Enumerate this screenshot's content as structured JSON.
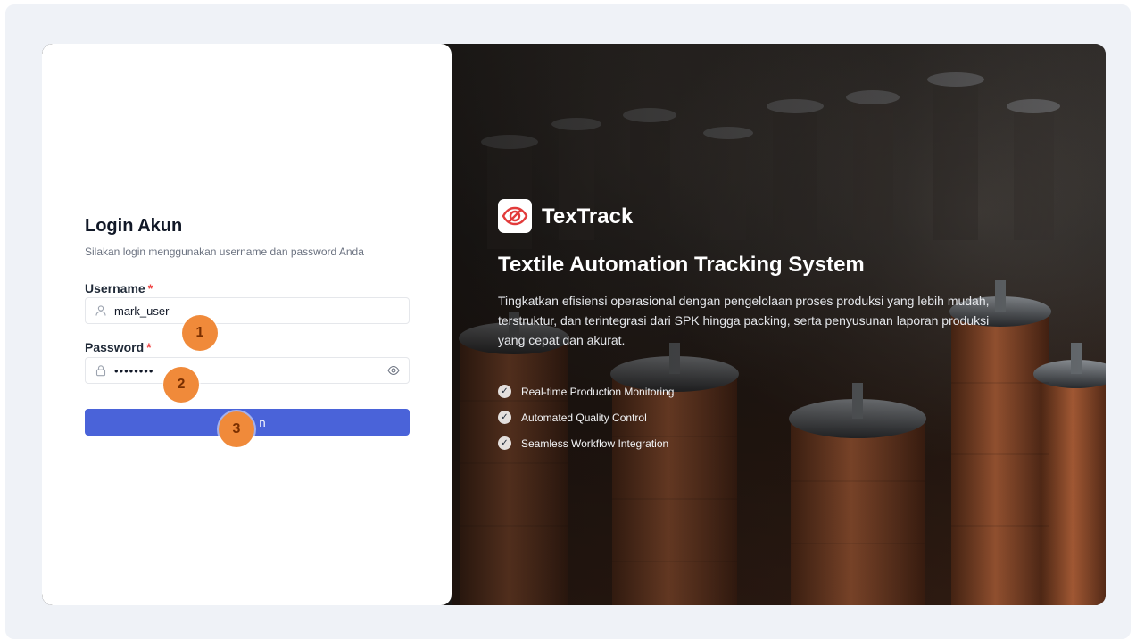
{
  "login": {
    "title": "Login Akun",
    "subtitle": "Silakan login menggunakan username dan password Anda",
    "username_label": "Username",
    "username_value": "mark_user",
    "password_label": "Password",
    "password_value": "password",
    "required_marker": "*",
    "submit_label": "n"
  },
  "steps": [
    "1",
    "2",
    "3"
  ],
  "hero": {
    "brand_name": "TexTrack",
    "title": "Textile Automation Tracking System",
    "description": "Tingkatkan efisiensi operasional dengan pengelolaan proses produksi yang lebih mudah, terstruktur, dan terintegrasi dari SPK hingga packing, serta penyusunan laporan produksi yang cepat dan akurat.",
    "features": [
      {
        "label": "Real-time Production Monitoring",
        "icon": "check-icon"
      },
      {
        "label": "Automated Quality Control",
        "icon": "check-icon"
      },
      {
        "label": "Seamless Workflow Integration",
        "icon": "check-icon"
      }
    ]
  },
  "icons": {
    "username": "user-icon",
    "password": "lock-icon",
    "toggle_password": "eye-icon",
    "brand": "textrack-logo-icon"
  },
  "colors": {
    "primary_button": "#4a63d9",
    "required": "#ef4444",
    "step_badge": "#f08a3a",
    "brand_red": "#e23b3b"
  }
}
